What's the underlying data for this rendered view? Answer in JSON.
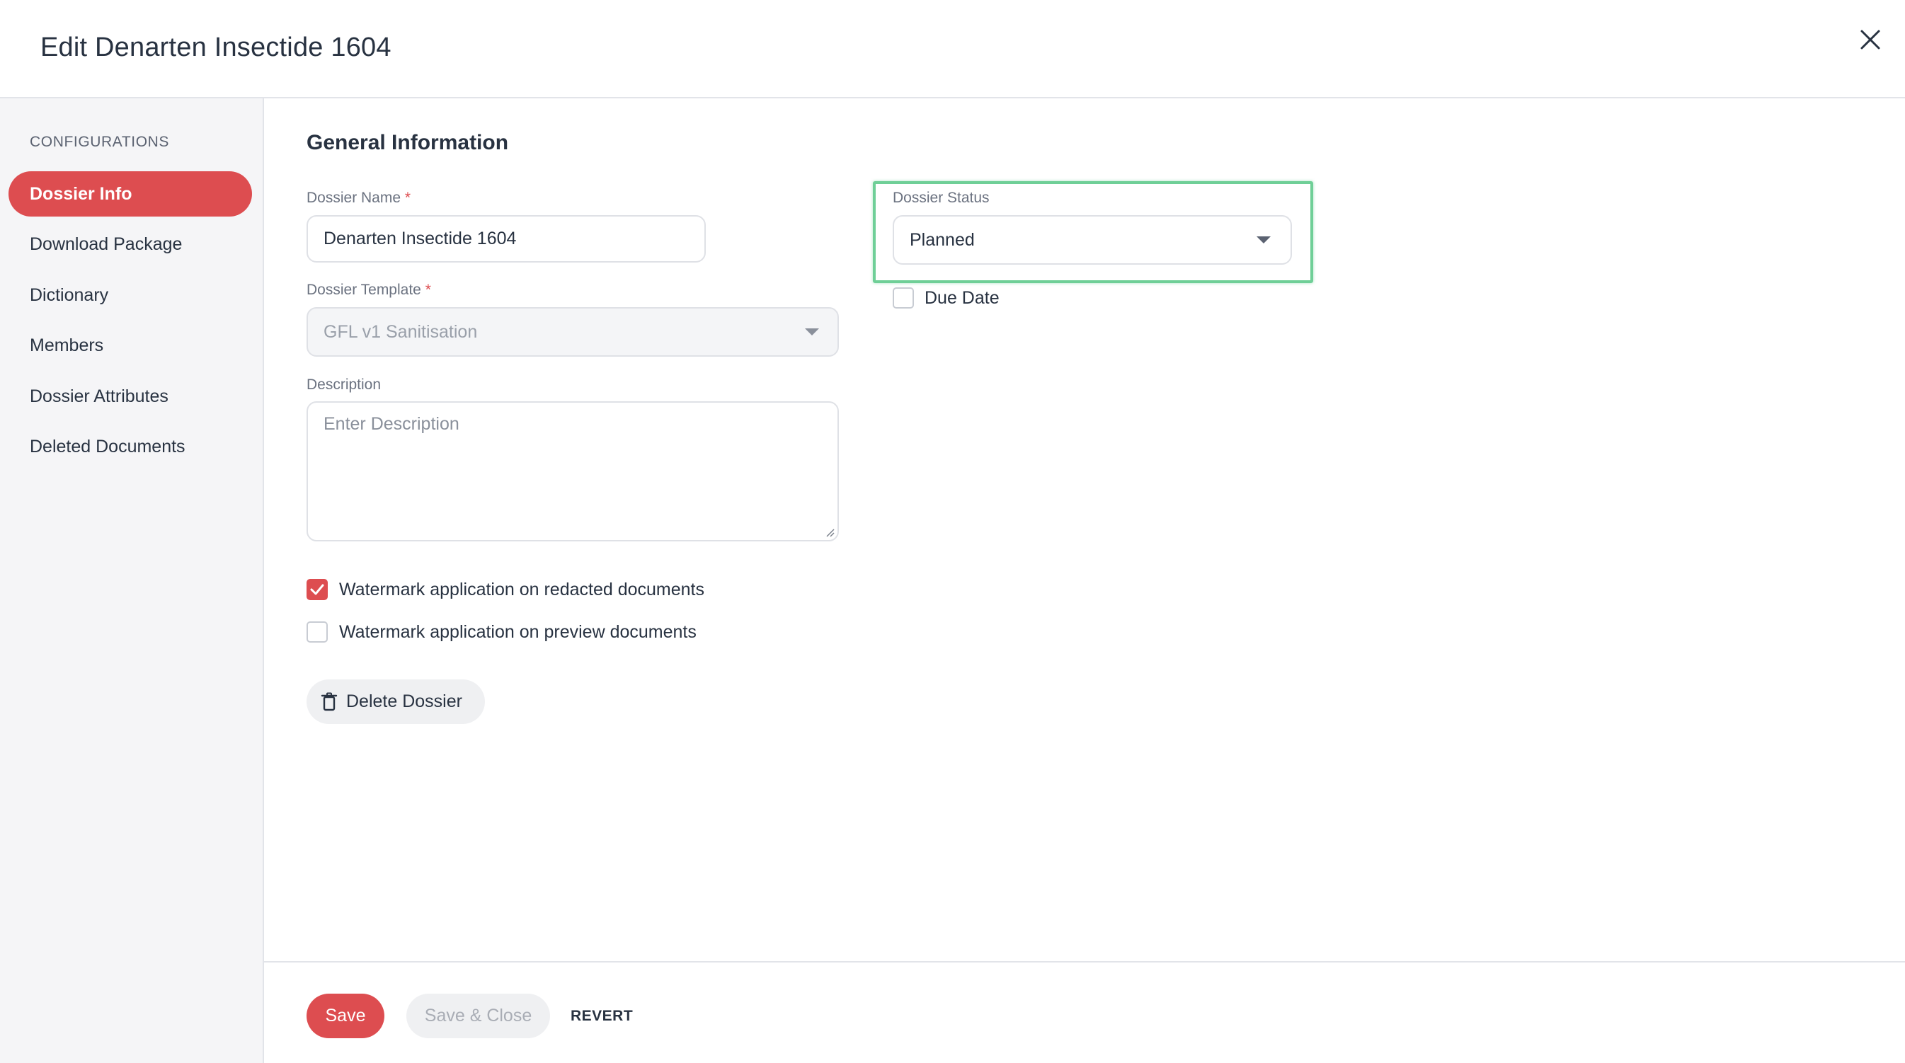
{
  "header": {
    "title": "Edit Denarten Insectide 1604",
    "close_icon": "close-icon"
  },
  "sidebar": {
    "heading": "CONFIGURATIONS",
    "items": [
      {
        "label": "Dossier Info",
        "active": true
      },
      {
        "label": "Download Package",
        "active": false
      },
      {
        "label": "Dictionary",
        "active": false
      },
      {
        "label": "Members",
        "active": false
      },
      {
        "label": "Dossier Attributes",
        "active": false
      },
      {
        "label": "Deleted Documents",
        "active": false
      }
    ]
  },
  "form": {
    "section_title": "General Information",
    "dossier_name": {
      "label": "Dossier Name",
      "required_mark": "*",
      "value": "Denarten Insectide 1604"
    },
    "dossier_template": {
      "label": "Dossier Template",
      "required_mark": "*",
      "value": "GFL v1 Sanitisation",
      "disabled": true
    },
    "description": {
      "label": "Description",
      "placeholder": "Enter Description",
      "value": ""
    },
    "dossier_status": {
      "label": "Dossier Status",
      "value": "Planned"
    },
    "due_date": {
      "label": "Due Date",
      "checked": false
    },
    "watermark_redacted": {
      "label": "Watermark application on redacted documents",
      "checked": true
    },
    "watermark_preview": {
      "label": "Watermark application on preview documents",
      "checked": false
    },
    "delete_button": {
      "label": "Delete Dossier",
      "icon": "trash-icon"
    }
  },
  "footer": {
    "save_label": "Save",
    "save_close_label": "Save & Close",
    "revert_label": "REVERT"
  },
  "colors": {
    "accent": "#dd4d50",
    "highlight": "#6fcf97",
    "text": "#283241",
    "sidebar_bg": "#f5f5f7"
  }
}
